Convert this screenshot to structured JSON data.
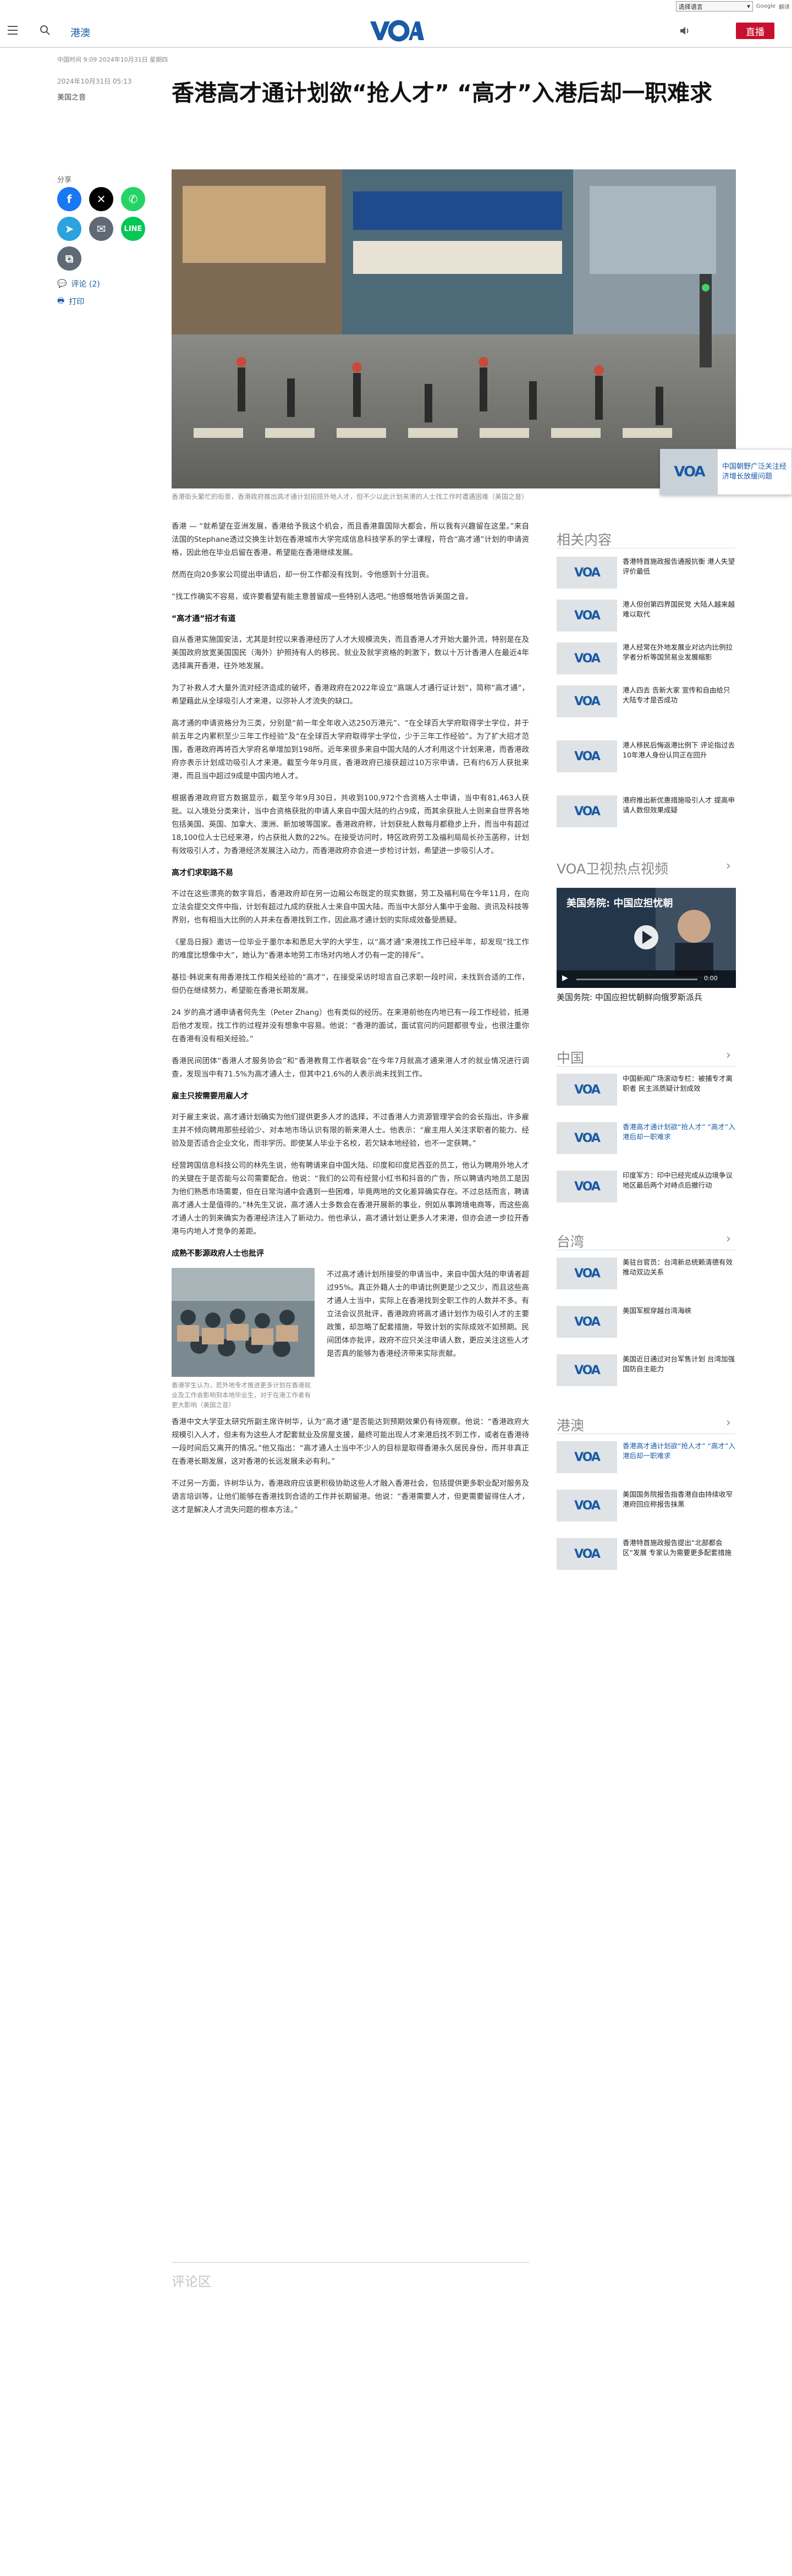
{
  "translate": {
    "select_label": "选择语言",
    "powered_by": "Google",
    "translate_label": "翻译"
  },
  "header": {
    "section": "港澳",
    "live_label": "直播",
    "logo_text": "VOA"
  },
  "article": {
    "meta_top": "中国时间 9:09 2024年10月31日 星期四",
    "date": "2024年10月31日 05:13",
    "byline": "美国之音",
    "title": "香港高才通计划欲“抢人才” “高才”入港后却一职难求",
    "share_label": "分享",
    "comments_label": "评论 (2)",
    "print_label": "打印",
    "hero_caption": "香港街头繁忙的街景，香港政府推出高才通计划招揽外地人才，但不少以此计划来港的人士找工作时遭遇困难（美国之音）",
    "paragraphs": {
      "p1": "香港 — “就希望在亚洲发展，香港给予我这个机会，而且香港靠国际大都会，所以我有兴趣留在这里。”来自法国的Stephane透过交换生计划在香港城市大学完成信息科技学系的学士课程，符合“高才通”计划的申请资格，因此他在毕业后留在香港，希望能在香港继续发展。",
      "p2": "然而在向20多家公司提出申请后，却一份工作都没有找到，令他感到十分沮丧。",
      "p3": "“找工作确实不容易，或许要看望有能主意普留成一些特别人选吧。”他感慨地告诉美国之音。",
      "h1": "“高才通”招才有道",
      "p4": "自从香港实施国安法，尤其是封控以来香港经历了人才大规模流失，而且香港人才开始大量外流，特别是在及美国政府放宽美国国民（海外）护照持有人的移民、就业及就学资格的刺激下，数以十万计香港人在最近4年选择离开香港，往外地发展。",
      "p5": "为了补救人才大量外流对经济造成的破坏，香港政府在2022年设立“高端人才通行证计划”，简称“高才通”，希望藉此从全球吸引人才来港，以弥补人才流失的缺口。",
      "p6": "高才通的申请资格分为三类，分别是“前一年全年收入达250万港元”、“在全球百大学府取得学士学位，并于前五年之内累积至少三年工作经验”及“在全球百大学府取得学士学位，少于三年工作经验”。为了扩大招才范围，香港政府再将百大学府名单增加到198所。近年来很多来自中国大陆的人才利用这个计划来港，而香港政府亦表示计划成功吸引人才来港。截至今年9月底，香港政府已接获超过10万宗申请，已有约6万人获批来港，而且当中超过9成是中国内地人才。",
      "p7": "根据香港政府官方数据显示，截至今年9月30日，共收到100,972个合资格人士申请，当中有81,463人获批。以入境处分类来计，当中合资格获批的申请人来自中国大陆的约占9成，而其余获批人士则来自世界各地包括美国、英国、加拿大、澳洲、新加坡等国家。香港政府称，计划获批人数每月都稳步上升，而当中有超过18,100位人士已经来港，约占获批人数的22%。在接受访问时，特区政府劳工及福利局局长孙玉菡称，计划有效吸引人才，为香港经济发展注入动力，而香港政府亦会进一步检讨计划，希望进一步吸引人才。",
      "h2": "高才们求职路不易",
      "p8": "不过在这些漂亮的数字背后，香港政府却在另一边厢公布既定的现实数据，劳工及福利局在今年11月，在向立法会提交文件中指，计划有超过九成的获批人士来自中国大陆，而当中大部分人集中于金融、资讯及科技等界别，也有相当大比例的人并未在香港找到工作，因此高才通计划的实际成效备受质疑。",
      "p9": "《星岛日报》邀访一位毕业于墨尔本和悉尼大学的大学生，以“高才通”来港找工作已经半年，却发现“找工作的难度比想像中大”，她认为“香港本地劳工市场对内地人才仍有一定的排斥”。",
      "p10": "基拉·韩说来有用香港找工作相关经验的“高才”，在接受采访时坦言自己求职一段时间，未找到合适的工作，但仍在继续努力，希望能在香港长期发展。",
      "p11": "24 岁的高才通申请者何先生（Peter Zhang）也有类似的经历。在来港前他在内地已有一段工作经验，抵港后他才发现，找工作的过程并没有想象中容易。他说：“香港的面试，面试官问的问题都很专业，也很注重你在香港有没有相关经验。”",
      "p12": "香港民间团体“香港人才服务协会”和“香港教育工作者联会”在今年7月就高才通来港人才的就业情况进行调查，发现当中有71.5%为高才通人士，但其中21.6%的人表示尚未找到工作。",
      "h3": "雇主只按需要用雇人才",
      "p13": "对于雇主来说，高才通计划确实为他们提供更多人才的选择，不过香港人力资源管理学会的会长指出，许多雇主并不倾向聘用那些经验少、对本地市场认识有限的新来港人士。他表示：“雇主用人关注求职者的能力、经验及是否适合企业文化，而非学历。即使某人毕业于名校，若欠缺本地经验，也不一定获聘。”",
      "p14": "经营跨国信息科技公司的林先生说，他有聘请来自中国大陆、印度和印度尼西亚的员工，他认为聘用外地人才的关键在于是否能与公司需要配合。他说：“我们的公司有经营小红书和抖音的广告，所以聘请内地员工是因为他们熟悉市场需要，但在日常沟通中会遇到一些困难，毕竟两地的文化差异确实存在。不过总括而言，聘请高才通人士是值得的。”林先生又说，高才通人士多数会在香港开展新的事业，例如从事跨境电商等，而这些高才通人士的到来确实为香港经济注入了新动力。他也承认，高才通计划让更多人才来港，但亦会进一步拉开香港与内地人才竞争的差距。",
      "h4": "成熟不影源政府人士也批评",
      "p15": "不过高才通计划所接受的申请当中，来自中国大陆的申请者超过95%。真正外籍人士的申请比例更是少之又少，而且这些高才通人士当中，实际上在香港找到全职工作的人数并不多。有立法会议员批评，香港政府将高才通计划作为吸引人才的主要政策，却忽略了配套措施，导致计划的实际成效不如预期。民间团体亦批评，政府不应只关注申请人数，更应关注这些人才是否真的能够为香港经济带来实际贡献。",
      "p16": "香港中文大学亚太研究所副主席许树华，认为“高才通”是否能达到预期效果仍有待观察。他说：“香港政府大规模引入人才，但未有为这些人才配套就业及房屋支援，最终可能出现人才来港后找不到工作，或者在香港待一段时间后又离开的情况。”他又指出：“高才通人士当中不少人的目标是取得香港永久居民身份，而并非真正在香港长期发展，这对香港的长远发展未必有利。”",
      "p17": "不过另一方面，许树华认为，香港政府应该更积极协助这些人才融入香港社会，包括提供更多职业配对服务及语言培训等，让他们能够在香港找到合适的工作并长期留港。他说：“香港需要人才，但更需要留得住人才，这才是解决人才流失问题的根本方法。”"
    },
    "inline_caption": "香港学生认为，若外地专才推进更多计划在香港就业及工作会影响到本地毕业生，对于在港工作者有更大影响（美国之音）",
    "comments_heading": "评论区"
  },
  "sidebar": {
    "related_heading": "相关内容",
    "related": [
      "香港特首施政报告通报抗衡 港人失望 评价最低",
      "港人但创第四界国民党 大陆人越来越难以取代",
      "港人经常在外地发展业对达内比例拉 学者分析等国贸易业发展缩影",
      "港人四去 告新大家 宣传和自由给只大陆专才是否成功",
      "港人移民后悔返港比例下 评论指过去10年港人身份认同正在回升",
      "港府推出新优惠措施吸引人才 提高申请人数但效果成疑"
    ],
    "video_heading": "VOA卫视热点视频",
    "video_overlay_title": "美国务院: 中国应担忧朝",
    "video_title": "美国务院: 中国应担忧朝鲜向俄罗斯派兵",
    "video_time": "0:00",
    "china_heading": "中国",
    "china": [
      "中国新闻广场滚动专栏：被捕专才离职者 民主派质疑计划成效",
      "香港高才通计划欲“抢人才” “高才”入港后却一职难求",
      "印度军方：印中已经完成从边境争议地区最后两个对峙点后撤行动"
    ],
    "taiwan_heading": "台湾",
    "taiwan": [
      "美驻台官员：台湾新总统赖清德有效推动双边关系",
      "美国军舰穿越台湾海峡",
      "美国近日通过对台军售计划 台湾加强国防自主能力"
    ],
    "hk_heading": "港澳",
    "hk": [
      "香港高才通计划欲“抢人才” “高才”入港后却一职难求",
      "美国国务院报告指香港自由持续收窄 港府回应称报告抹黑",
      "香港特首施政报告提出“北部都会区”发展 专家认为需要更多配套措施"
    ],
    "float_player_text": "中国朝野广泛关注经济增长放缓问题"
  }
}
